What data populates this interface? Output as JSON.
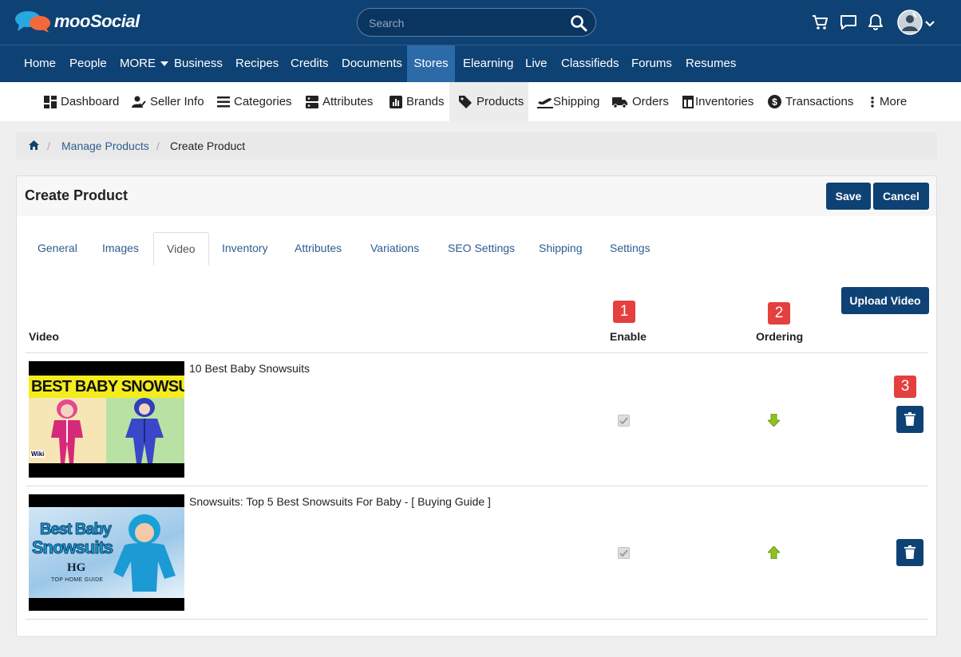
{
  "app": {
    "name": "mooSocial"
  },
  "search": {
    "placeholder": "Search"
  },
  "main_nav": {
    "items": [
      {
        "label": "Home"
      },
      {
        "label": "People"
      },
      {
        "label": "MORE"
      },
      {
        "label": "Business"
      },
      {
        "label": "Recipes"
      },
      {
        "label": "Credits"
      },
      {
        "label": "Documents"
      },
      {
        "label": "Stores"
      },
      {
        "label": "Elearning"
      },
      {
        "label": "Live"
      },
      {
        "label": "Classifieds"
      },
      {
        "label": "Forums"
      },
      {
        "label": "Resumes"
      }
    ],
    "active": "Stores"
  },
  "sub_nav": {
    "items": [
      {
        "label": "Dashboard",
        "icon": "dashboard-icon"
      },
      {
        "label": "Seller Info",
        "icon": "seller-icon"
      },
      {
        "label": "Categories",
        "icon": "list-icon"
      },
      {
        "label": "Attributes",
        "icon": "attributes-icon"
      },
      {
        "label": "Brands",
        "icon": "brands-icon"
      },
      {
        "label": "Products",
        "icon": "tag-icon"
      },
      {
        "label": "Shipping",
        "icon": "plane-icon"
      },
      {
        "label": "Orders",
        "icon": "truck-icon"
      },
      {
        "label": "Inventories",
        "icon": "inventory-icon"
      },
      {
        "label": "Transactions",
        "icon": "dollar-icon"
      },
      {
        "label": "More",
        "icon": "more-icon"
      }
    ],
    "active": "Products"
  },
  "breadcrumb": {
    "link": "Manage Products",
    "current": "Create Product"
  },
  "card": {
    "title": "Create Product",
    "save_label": "Save",
    "cancel_label": "Cancel",
    "upload_label": "Upload Video"
  },
  "tabs": [
    {
      "label": "General"
    },
    {
      "label": "Images"
    },
    {
      "label": "Video"
    },
    {
      "label": "Inventory"
    },
    {
      "label": "Attributes"
    },
    {
      "label": "Variations"
    },
    {
      "label": "SEO Settings"
    },
    {
      "label": "Shipping"
    },
    {
      "label": "Settings"
    }
  ],
  "active_tab": "Video",
  "table": {
    "headers": {
      "video": "Video",
      "enable": "Enable",
      "ordering": "Ordering"
    },
    "rows": [
      {
        "title": "10 Best Baby Snowsuits",
        "thumb_text": "BEST BABY SNOWSUITS",
        "thumb_caption": "Wiki",
        "enabled": true,
        "ordering_direction": "down"
      },
      {
        "title": "Snowsuits: Top 5 Best Snowsuits For Baby - [ Buying Guide ]",
        "thumb_text_1": "Best Baby",
        "thumb_text_2": "Snowsuits",
        "thumb_caption": "TOP HOME GUIDE",
        "thumb_logo": "HG",
        "enabled": true,
        "ordering_direction": "up"
      }
    ]
  },
  "badges": [
    "1",
    "2",
    "3"
  ],
  "colors": {
    "brand": "#0f4274",
    "nav_active": "#2d6aa8",
    "badge": "#e3403f",
    "arrow": "#8dc21f"
  }
}
